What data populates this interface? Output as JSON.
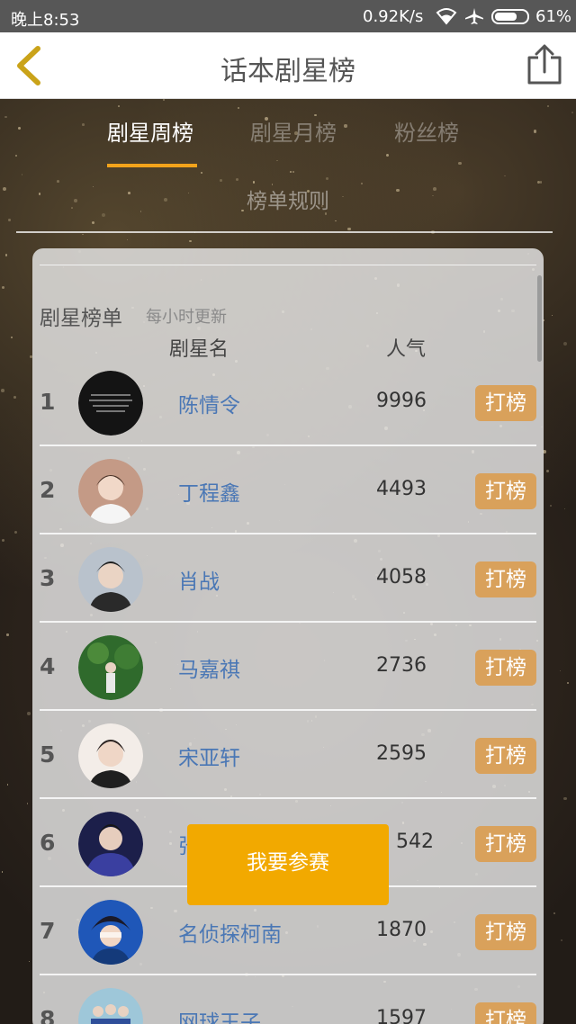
{
  "status_bar": {
    "time": "晚上8:53",
    "net_speed": "0.92K/s",
    "battery": "61%",
    "icons": [
      "wifi-icon",
      "airplane-icon",
      "battery-icon"
    ]
  },
  "header": {
    "title": "话本剧星榜",
    "back_icon": "chevron-left-icon",
    "share_icon": "share-icon"
  },
  "tabs": [
    {
      "label": "剧星周榜",
      "active": true
    },
    {
      "label": "剧星月榜",
      "active": false
    },
    {
      "label": "粉丝榜",
      "active": false
    }
  ],
  "rules_label": "榜单规则",
  "list": {
    "title": "剧星榜单",
    "subtitle": "每小时更新",
    "col_name": "剧星名",
    "col_popularity": "人气",
    "action_label": "打榜",
    "rows": [
      {
        "rank": "1",
        "name": "陈情令",
        "popularity": "9996"
      },
      {
        "rank": "2",
        "name": "丁程鑫",
        "popularity": "4493"
      },
      {
        "rank": "3",
        "name": "肖战",
        "popularity": "4058"
      },
      {
        "rank": "4",
        "name": "马嘉祺",
        "popularity": "2736"
      },
      {
        "rank": "5",
        "name": "宋亚轩",
        "popularity": "2595"
      },
      {
        "rank": "6",
        "name": "张",
        "popularity": "542"
      },
      {
        "rank": "7",
        "name": "名侦探柯南",
        "popularity": "1870"
      },
      {
        "rank": "8",
        "name": "网球王子",
        "popularity": "1597"
      }
    ]
  },
  "join_button": "我要参赛",
  "colors": {
    "accent": "#f2a31b",
    "action_button": "#d9a15b",
    "name_link": "#4a77b5",
    "join_button": "#f2a900"
  }
}
